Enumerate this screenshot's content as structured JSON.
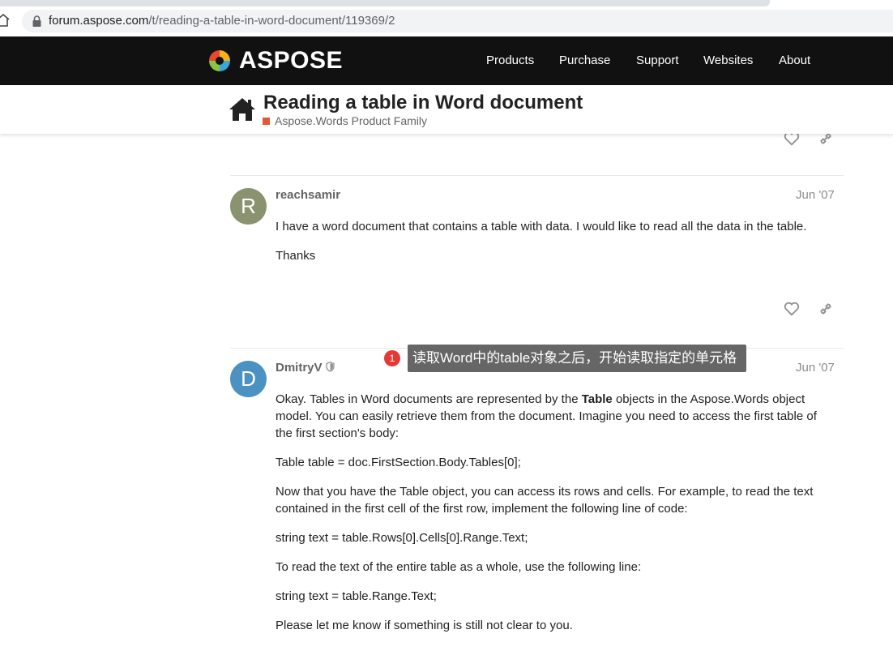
{
  "browser": {
    "url_host": "forum.aspose.com",
    "url_path": "/t/reading-a-table-in-word-document/119369/2"
  },
  "header": {
    "logo_text": "ASPOSE",
    "nav": [
      "Products",
      "Purchase",
      "Support",
      "Websites",
      "About"
    ]
  },
  "topic": {
    "title": "Reading a table in Word document",
    "category": "Aspose.Words Product Family",
    "category_color": "#e45735"
  },
  "posts": [
    {
      "avatar_letter": "R",
      "avatar_color": "#8a9370",
      "username": "reachsamir",
      "date": "Jun '07",
      "paragraphs": [
        "I have a word document that contains a table with data. I would like to read all the data in the table.",
        "Thanks"
      ]
    },
    {
      "avatar_letter": "D",
      "avatar_color": "#4b92c3",
      "username": "DmitryV",
      "date": "Jun '07",
      "p1_before": "Okay. Tables in Word documents are represented by the ",
      "p1_bold": "Table",
      "p1_after": " objects in the Aspose.Words object model. You can easily retrieve them from the document. Imagine you need to access the first table of the first section's body:",
      "paragraphs": [
        "Table table = doc.FirstSection.Body.Tables[0];",
        "Now that you have the Table object, you can access its rows and cells. For example, to read the text contained in the first cell of the first row, implement the following line of code:",
        "string text = table.Rows[0].Cells[0].Range.Text;",
        "To read the text of the entire table as a whole, use the following line:",
        "string text = table.Range.Text;",
        "Please let me know if something is still not clear to you."
      ]
    }
  ],
  "annotation": {
    "badge": "1",
    "text": "读取Word中的table对象之后，开始读取指定的单元格"
  },
  "icons": {
    "like": "heart-icon",
    "link": "link-icon",
    "moderator": "shield-icon"
  }
}
